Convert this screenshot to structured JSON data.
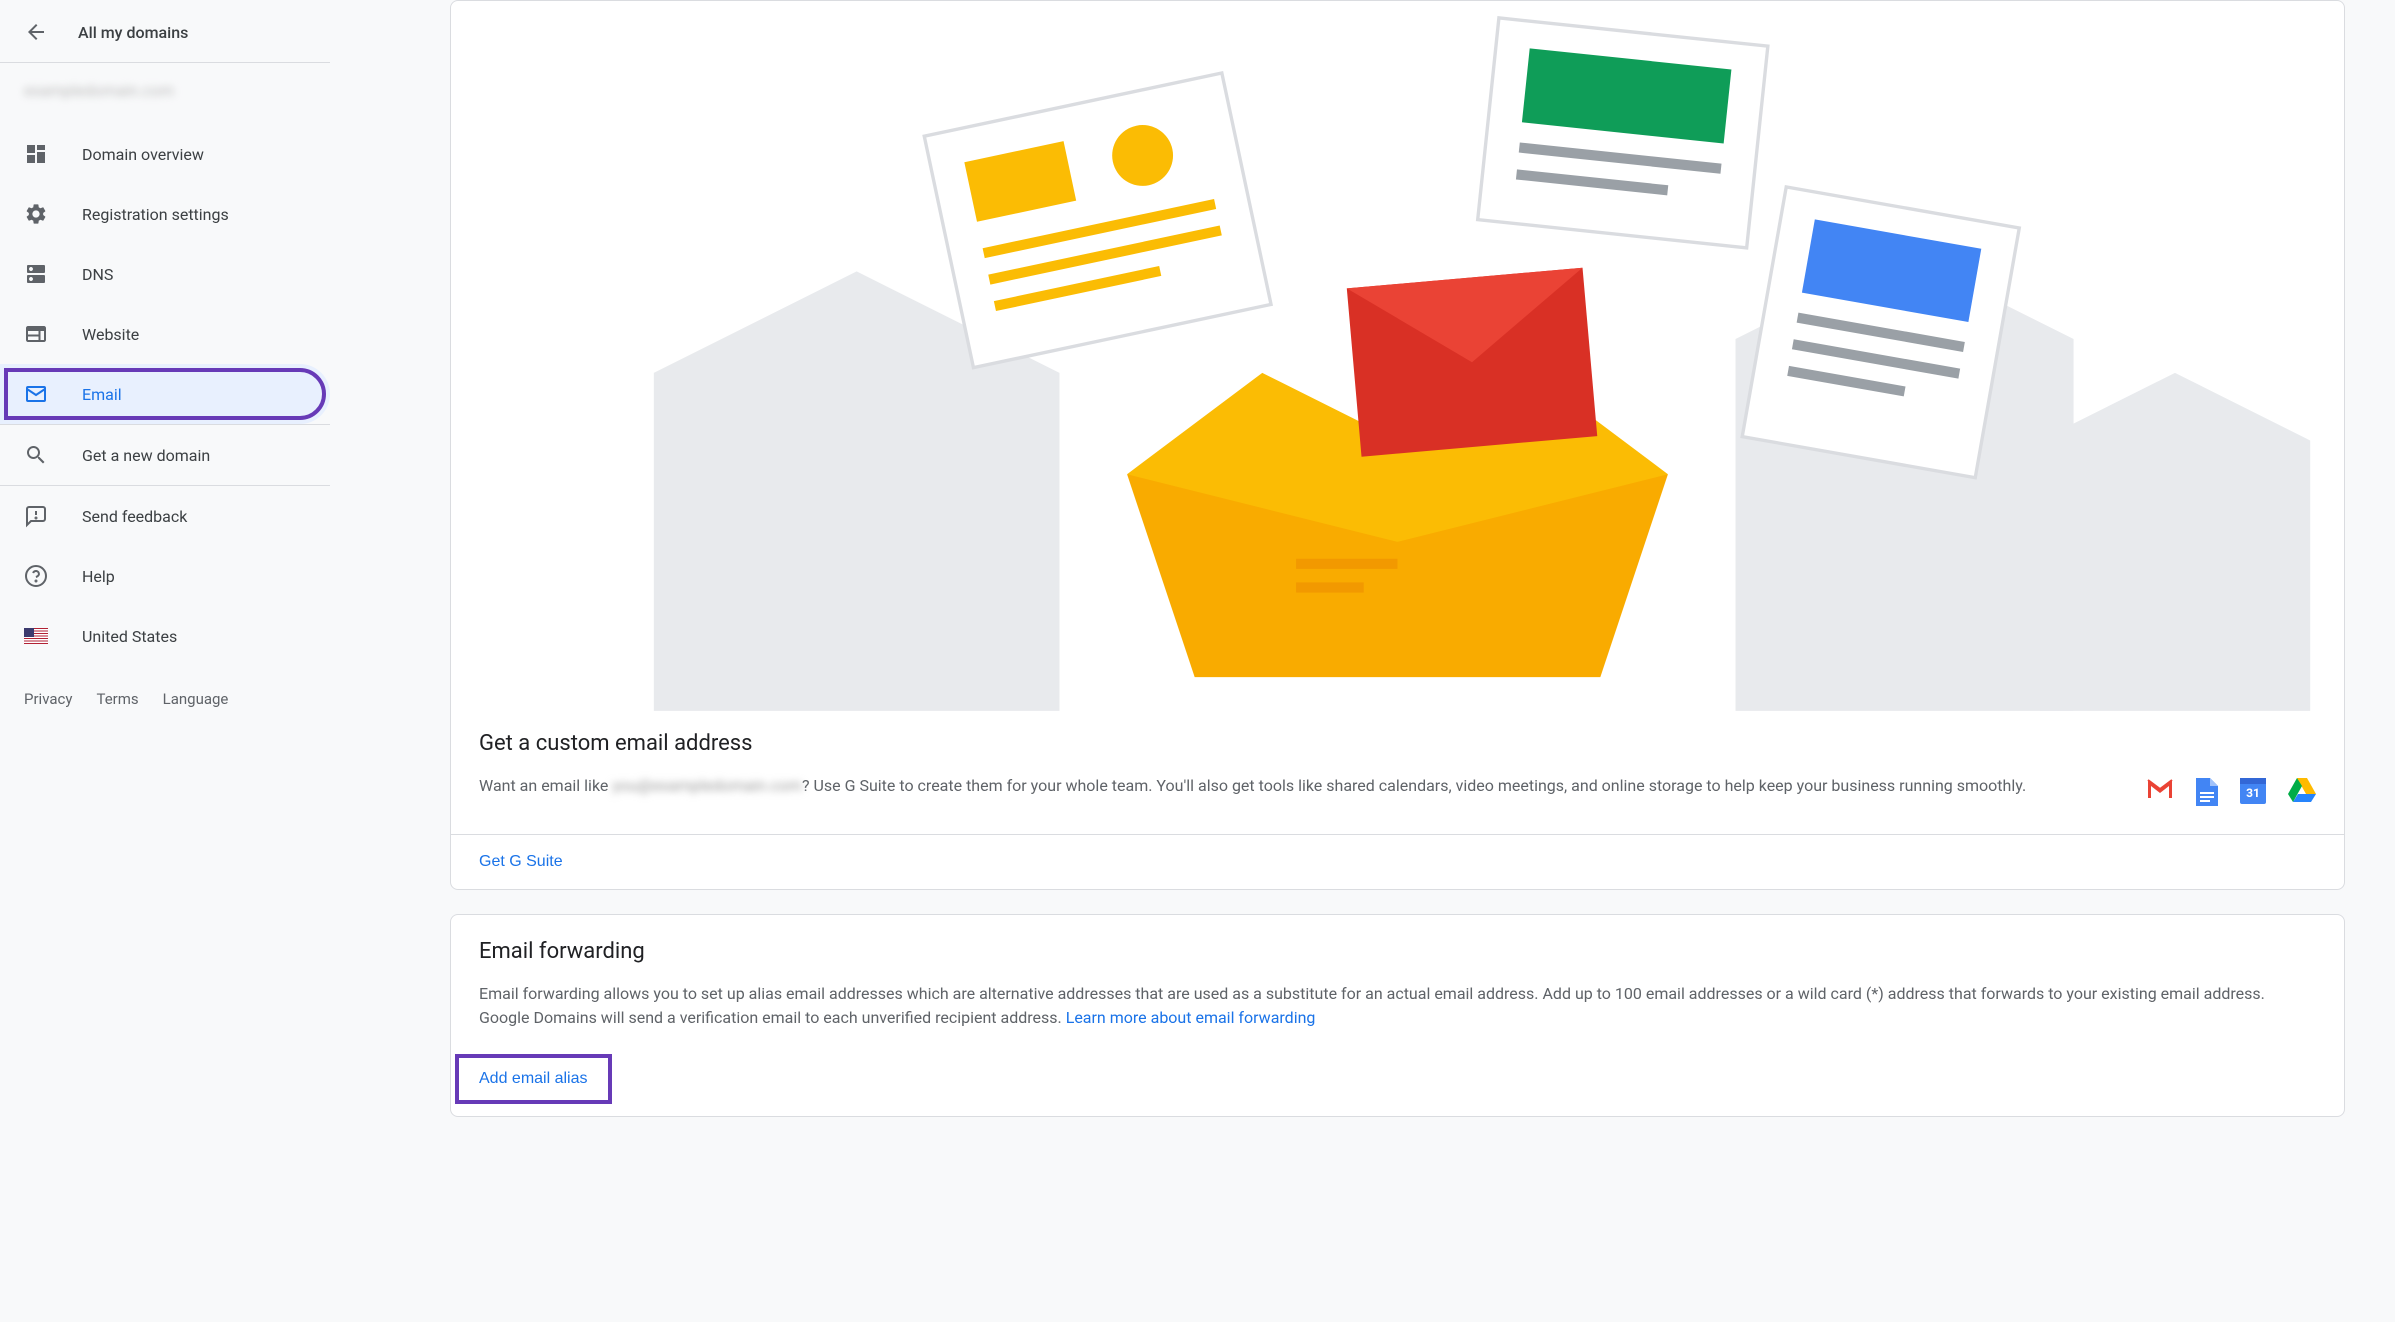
{
  "sidebar": {
    "back_title": "All my domains",
    "domain_name": "exampledomain.com",
    "items": [
      {
        "label": "Domain overview"
      },
      {
        "label": "Registration settings"
      },
      {
        "label": "DNS"
      },
      {
        "label": "Website"
      },
      {
        "label": "Email"
      },
      {
        "label": "Get a new domain"
      },
      {
        "label": "Send feedback"
      },
      {
        "label": "Help"
      },
      {
        "label": "United States"
      }
    ],
    "footer": {
      "privacy": "Privacy",
      "terms": "Terms",
      "language": "Language"
    }
  },
  "gsuite": {
    "title": "Get a custom email address",
    "text_pre": "Want an email like ",
    "text_blurred": "you@exampledomain.com",
    "text_post": "? Use G Suite to create them for your whole team. You'll also get tools like shared calendars, video meetings, and online storage to help keep your business running smoothly.",
    "cta": "Get G Suite"
  },
  "forwarding": {
    "title": "Email forwarding",
    "text": "Email forwarding allows you to set up alias email addresses which are alternative addresses that are used as a substitute for an actual email address. Add up to 100 email addresses or a wild card (*) address that forwards to your existing email address. Google Domains will send a verification email to each unverified recipient address. ",
    "learn_more": "Learn more about email forwarding",
    "add_alias": "Add email alias"
  }
}
